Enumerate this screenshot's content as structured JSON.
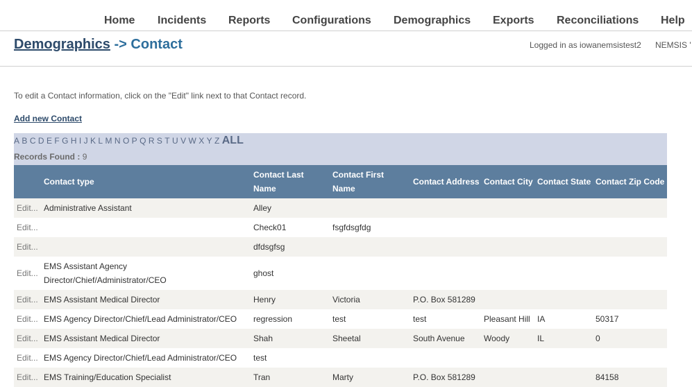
{
  "nav": {
    "items": [
      "Home",
      "Incidents",
      "Reports",
      "Configurations",
      "Demographics",
      "Exports",
      "Reconciliations",
      "Help"
    ]
  },
  "header": {
    "crumb_parent": "Demographics",
    "crumb_separator": "->",
    "crumb_current": "Contact",
    "login_text": "Logged in as iowanemsistest2",
    "nemsis_text": "NEMSIS '"
  },
  "instructions": "To edit a Contact information, click on the \"Edit\" link next to that Contact record.",
  "add_contact_label": "Add new Contact",
  "filter": {
    "letters": [
      "A",
      "B",
      "C",
      "D",
      "E",
      "F",
      "G",
      "H",
      "I",
      "J",
      "K",
      "L",
      "M",
      "N",
      "O",
      "P",
      "Q",
      "R",
      "S",
      "T",
      "U",
      "V",
      "W",
      "X",
      "Y",
      "Z"
    ],
    "all_label": "ALL",
    "records_label": "Records Found :",
    "records_count": "9"
  },
  "table": {
    "headers": {
      "type": "Contact type",
      "last": "Contact Last Name",
      "first": "Contact First Name",
      "address": "Contact Address",
      "city": "Contact City",
      "state": "Contact State",
      "zip": "Contact Zip Code"
    },
    "edit_label": "Edit...",
    "rows": [
      {
        "type": "Administrative Assistant",
        "last": "Alley",
        "first": "",
        "address": "",
        "city": "",
        "state": "",
        "zip": ""
      },
      {
        "type": "",
        "last": "Check01",
        "first": "fsgfdsgfdg",
        "address": "",
        "city": "",
        "state": "",
        "zip": ""
      },
      {
        "type": "",
        "last": "dfdsgfsg",
        "first": "",
        "address": "",
        "city": "",
        "state": "",
        "zip": ""
      },
      {
        "type": "EMS Assistant Agency Director/Chief/Administrator/CEO",
        "last": "ghost",
        "first": "",
        "address": "",
        "city": "",
        "state": "",
        "zip": ""
      },
      {
        "type": "EMS Assistant Medical Director",
        "last": "Henry",
        "first": "Victoria",
        "address": "P.O. Box 581289",
        "city": "",
        "state": "",
        "zip": ""
      },
      {
        "type": "EMS Agency Director/Chief/Lead Administrator/CEO",
        "last": "regression",
        "first": "test",
        "address": "test",
        "city": "Pleasant Hill",
        "state": "IA",
        "zip": "50317"
      },
      {
        "type": "EMS Assistant Medical Director",
        "last": "Shah",
        "first": "Sheetal",
        "address": "South Avenue",
        "city": "Woody",
        "state": "IL",
        "zip": "0"
      },
      {
        "type": "EMS Agency Director/Chief/Lead Administrator/CEO",
        "last": "test",
        "first": "",
        "address": "",
        "city": "",
        "state": "",
        "zip": ""
      },
      {
        "type": "EMS Training/Education Specialist",
        "last": "Tran",
        "first": "Marty",
        "address": "P.O. Box 581289",
        "city": "",
        "state": "",
        "zip": "84158"
      }
    ]
  }
}
